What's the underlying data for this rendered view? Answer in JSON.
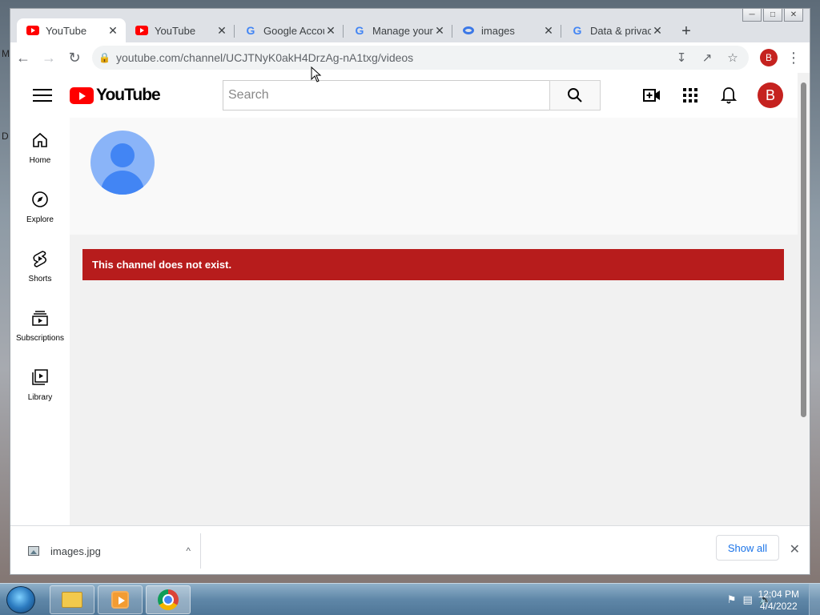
{
  "desktop": {
    "letters": [
      "M",
      "D"
    ]
  },
  "browser": {
    "window_controls": [
      "minimize",
      "maximize",
      "close"
    ],
    "tabs": [
      {
        "title": "YouTube",
        "favicon": "youtube-favicon",
        "active": true
      },
      {
        "title": "YouTube",
        "favicon": "youtube-favicon",
        "active": false
      },
      {
        "title": "Google Accounts",
        "favicon": "google-favicon",
        "active": false
      },
      {
        "title": "Manage your Google Account",
        "favicon": "google-favicon",
        "active": false
      },
      {
        "title": "images",
        "favicon": "images-favicon",
        "active": false
      },
      {
        "title": "Data & privacy",
        "favicon": "google-favicon",
        "active": false
      }
    ],
    "url": "youtube.com/channel/UCJTNyK0akH4DrzAg-nA1txg/videos",
    "profile_initial": "B"
  },
  "youtube": {
    "logo_text": "YouTube",
    "search_placeholder": "Search",
    "avatar_initial": "B",
    "guide": [
      {
        "label": "Home",
        "icon": "home-icon"
      },
      {
        "label": "Explore",
        "icon": "compass-icon"
      },
      {
        "label": "Shorts",
        "icon": "shorts-icon"
      },
      {
        "label": "Subscriptions",
        "icon": "subscriptions-icon"
      },
      {
        "label": "Library",
        "icon": "library-icon"
      }
    ],
    "error_message": "This channel does not exist."
  },
  "downloads": {
    "file_name": "images.jpg",
    "show_all_label": "Show all"
  },
  "taskbar": {
    "time": "12:04 PM",
    "date": "4/4/2022"
  },
  "colors": {
    "youtube_red": "#ff0000",
    "error_banner": "#b71c1c",
    "avatar_red": "#c5221f",
    "link_blue": "#1a73e8"
  }
}
